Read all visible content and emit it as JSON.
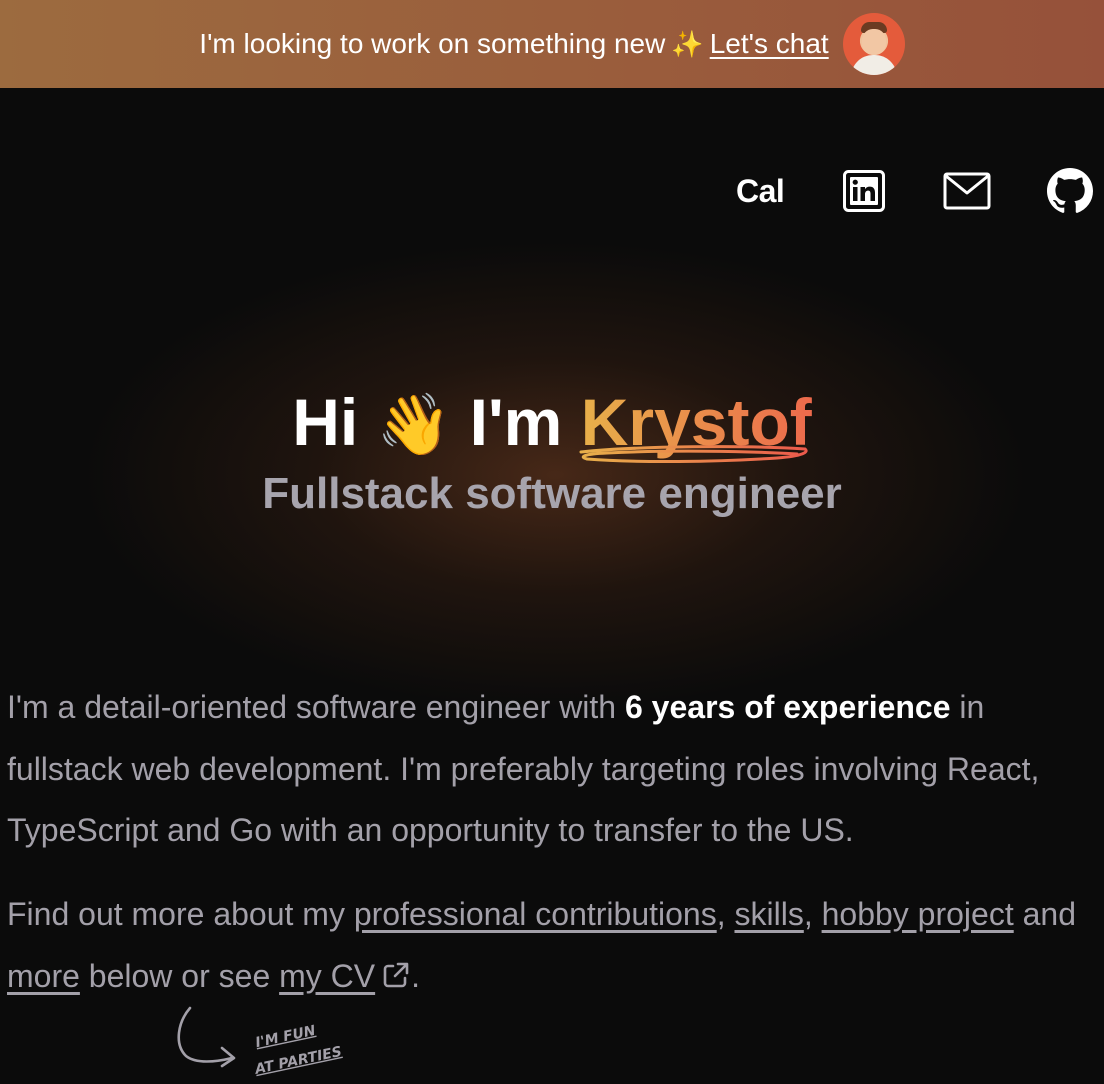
{
  "banner": {
    "text": "I'm looking to work on something new",
    "sparkle": "✨",
    "link_label": "Let's chat",
    "avatar_icon": "profile-avatar"
  },
  "social": {
    "cal_label": "Cal",
    "icons": [
      "linkedin-icon",
      "mail-icon",
      "github-icon"
    ]
  },
  "hero": {
    "greeting": "Hi",
    "wave": "👋",
    "im": "I'm",
    "name": "Krystof",
    "subtitle": "Fullstack software engineer"
  },
  "intro": {
    "part1": "I'm a detail-oriented software engineer with ",
    "highlight": "6 years of experience",
    "part2": " in fullstack web development. I'm preferably targeting roles involving React, TypeScript and Go with an opportunity to transfer to the US."
  },
  "more": {
    "prefix": "Find out more about my ",
    "link_contributions": "professional contributions",
    "sep1": ", ",
    "link_skills": "skills",
    "sep2": ", ",
    "link_hobby": "hobby project",
    "and": " and ",
    "link_more": "more",
    "middle": " below or see ",
    "link_cv": "my CV",
    "end": "."
  },
  "doodle": {
    "line1": "I'M FUN",
    "line2": "AT PARTIES"
  },
  "colors": {
    "banner_start": "#9c6b3f",
    "banner_end": "#96513a",
    "background": "#0b0b0b",
    "name_gradient_start": "#e8b04a",
    "name_gradient_end": "#ec6a4c",
    "muted_text": "#a3a0a9"
  }
}
